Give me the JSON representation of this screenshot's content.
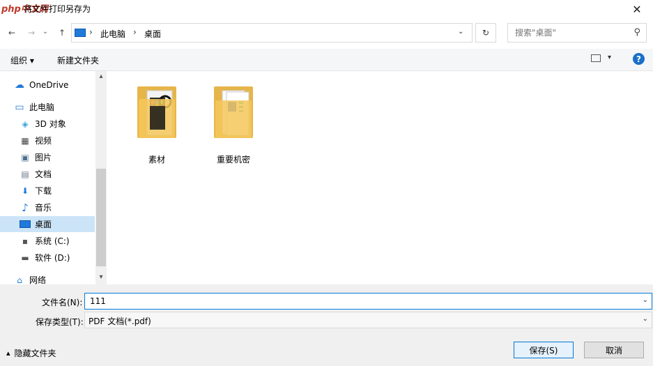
{
  "window": {
    "logo_text": "php中文网",
    "title": "将文件打印另存为",
    "close_glyph": "✕"
  },
  "nav": {
    "back_glyph": "←",
    "forward_glyph": "→",
    "recent_glyph": "⌄",
    "up_glyph": "↑",
    "breadcrumb": [
      "此电脑",
      "桌面"
    ],
    "breadcrumb_sep": "›",
    "dropdown_glyph": "⌄",
    "refresh_glyph": "↻",
    "search_placeholder": "搜索\"桌面\"",
    "search_glyph": "⚲"
  },
  "toolbar": {
    "organize_label": "组织 ▾",
    "new_folder_label": "新建文件夹",
    "view_drop_glyph": "▾",
    "help_glyph": "?"
  },
  "sidebar": {
    "items": [
      {
        "label": "OneDrive",
        "icon": "cloud-icon",
        "glyph": "☁"
      },
      {
        "label": "此电脑",
        "icon": "computer-icon",
        "glyph": "▭"
      },
      {
        "label": "3D 对象",
        "icon": "cube-icon",
        "glyph": "◈"
      },
      {
        "label": "视频",
        "icon": "video-icon",
        "glyph": "▦"
      },
      {
        "label": "图片",
        "icon": "picture-icon",
        "glyph": "▣"
      },
      {
        "label": "文档",
        "icon": "document-icon",
        "glyph": "▤"
      },
      {
        "label": "下载",
        "icon": "download-icon",
        "glyph": "⬇"
      },
      {
        "label": "音乐",
        "icon": "music-icon",
        "glyph": "♪"
      },
      {
        "label": "桌面",
        "icon": "desktop-icon",
        "glyph": "▬"
      },
      {
        "label": "系统 (C:)",
        "icon": "drive-c-icon",
        "glyph": "▪"
      },
      {
        "label": "软件 (D:)",
        "icon": "drive-d-icon",
        "glyph": "▬"
      },
      {
        "label": "网络",
        "icon": "network-icon",
        "glyph": "⌂"
      }
    ],
    "selected": "桌面",
    "scroll_up": "▴",
    "scroll_down": "▾"
  },
  "files": [
    {
      "label": "素材",
      "icon": "folder-media-icon"
    },
    {
      "label": "重要机密",
      "icon": "folder-docs-icon"
    }
  ],
  "form": {
    "filename_label": "文件名(N):",
    "filename_value": "111",
    "filetype_label": "保存类型(T):",
    "filetype_value": "PDF 文档(*.pdf)",
    "drop_glyph": "⌄"
  },
  "footer": {
    "hide_folders_label": "隐藏文件夹",
    "hide_glyph": "▴",
    "save_label": "保存(S)",
    "cancel_label": "取消"
  },
  "colors": {
    "accent": "#0078d7",
    "folder": "#f5c75a",
    "selected_bg": "#cce4f7"
  }
}
